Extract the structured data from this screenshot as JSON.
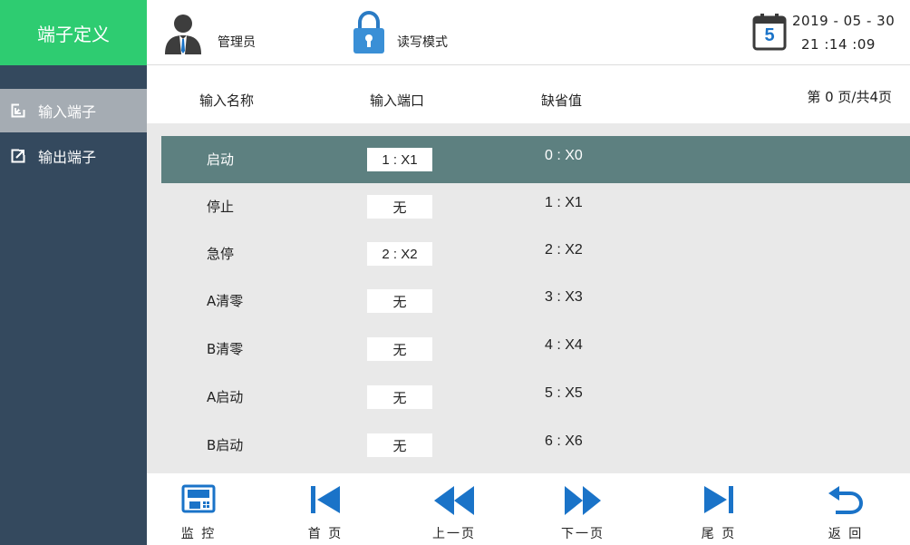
{
  "app_title": "端子定义",
  "topbar": {
    "user_label": "管理员",
    "mode_label": "读写模式",
    "calendar_day": "5",
    "date": "2019 - 05 - 30",
    "time": "21 :14 :09"
  },
  "sidebar": {
    "items": [
      {
        "label": "输入端子",
        "icon": "import-icon",
        "active": true
      },
      {
        "label": "输出端子",
        "icon": "export-icon",
        "active": false
      }
    ]
  },
  "table": {
    "headers": {
      "name": "输入名称",
      "port": "输入端口",
      "default": "缺省值"
    },
    "page_info": "第 0 页/共4页",
    "rows": [
      {
        "name": "启动",
        "port": "1 :  X1",
        "default": "0 :  X0",
        "selected": true
      },
      {
        "name": "停止",
        "port": "无",
        "default": "1 :  X1"
      },
      {
        "name": "急停",
        "port": "2 :  X2",
        "default": "2 :  X2"
      },
      {
        "name": "A清零",
        "port": "无",
        "default": "3 :  X3"
      },
      {
        "name": "B清零",
        "port": "无",
        "default": "4 :  X4"
      },
      {
        "name": "A启动",
        "port": "无",
        "default": "5 :  X5"
      },
      {
        "name": "B启动",
        "port": "无",
        "default": "6 :  X6"
      }
    ]
  },
  "toolbar": {
    "items": [
      {
        "label": "监 控",
        "icon": "monitor-icon"
      },
      {
        "label": "首 页",
        "icon": "first-page-icon"
      },
      {
        "label": "上一页",
        "icon": "prev-page-icon"
      },
      {
        "label": "下一页",
        "icon": "next-page-icon"
      },
      {
        "label": "尾 页",
        "icon": "last-page-icon"
      },
      {
        "label": "返 回",
        "icon": "return-icon"
      }
    ]
  },
  "colors": {
    "title_green": "#2ecc71",
    "sidebar_bg": "#34495e",
    "sidebar_active": "#a5acb3",
    "selected_row": "#5d8080",
    "icon_blue": "#1a73c8"
  }
}
